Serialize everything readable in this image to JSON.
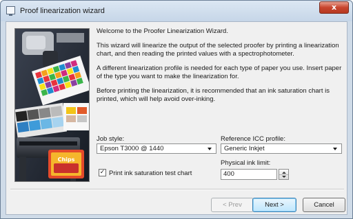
{
  "window": {
    "title": "Proof linearization wizard",
    "close_label": "x"
  },
  "intro": {
    "welcome": "Welcome to the Proofer Linearization Wizard.",
    "para1": "This wizard will linearize the output of the selected proofer by printing a linearization chart, and then reading the printed values with a spectrophotometer.",
    "para2": "A different linearization profile is needed for each type of paper you use. Insert paper of the type you want to make the linearization for.",
    "para3": "Before printing the linearization, it is recommended that an ink saturation chart is printed, which will help avoid over-inking."
  },
  "form": {
    "job_style_label": "Job style:",
    "job_style_value": "Epson T3000 @ 1440",
    "icc_label": "Reference ICC profile:",
    "icc_value": "Generic Inkjet",
    "ink_limit_label": "Physical ink limit:",
    "ink_limit_value": "400",
    "checkbox_label": "Print ink saturation test chart",
    "checkbox_checked": true,
    "checkbox_mark": "✓"
  },
  "buttons": {
    "prev": "< Prev",
    "next": "Next >",
    "cancel": "Cancel"
  },
  "image": {
    "pouch_text": "Chips",
    "icon_name": "printer-wizard-illustration"
  },
  "colors": {
    "accent": "#3c7fb1",
    "close": "#c8452e"
  }
}
